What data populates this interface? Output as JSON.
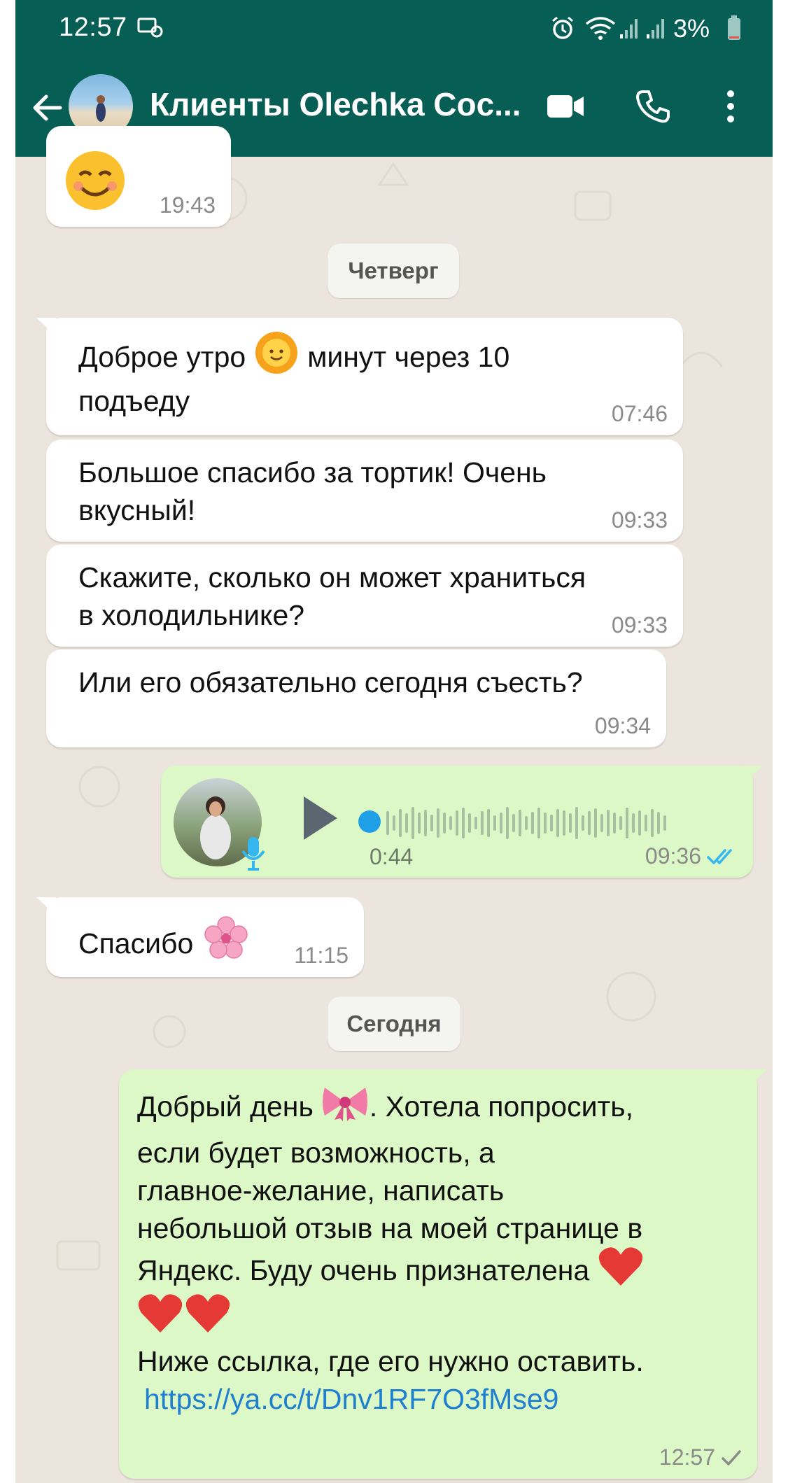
{
  "status": {
    "time": "12:57",
    "battery": "3%"
  },
  "header": {
    "title": "Клиенты Olechka Coc..."
  },
  "messages": {
    "m0_time": "19:43",
    "day1": "Четверг",
    "m1_line1": "Доброе утро",
    "m1_line1b": "минут через 10",
    "m1_line2": "подъеду",
    "m1_time": "07:46",
    "m2_line1": "Большое спасибо за тортик! Очень",
    "m2_line2": "вкусный!",
    "m2_time": "09:33",
    "m3_line1": "Скажите, сколько он может храниться",
    "m3_line2": "в холодильнике?",
    "m3_time": "09:33",
    "m4_line1": "Или его обязательно сегодня съесть?",
    "m4_time": "09:34",
    "voice_duration": "0:44",
    "voice_time": "09:36",
    "voice_progress": 0,
    "m6_text": "Спасибо",
    "m6_time": "11:15",
    "day2": "Сегодня",
    "m7_l1a": "Добрый день",
    "m7_l1b": ".  Хотела попросить,",
    "m7_l2": "если будет возможность,  а",
    "m7_l3": "главное-желание,  написать",
    "m7_l4": "небольшой отзыв на моей странице в",
    "m7_l5": "Яндекс.  Буду очень признателена",
    "m7_l7": "Ниже ссылка, где его нужно оставить.",
    "m7_link": "https://ya.cc/t/Dnv1RF7O3fMse9",
    "m7_time": "12:57"
  },
  "icons": {
    "back": "arrow-left-icon",
    "video": "video-camera-icon",
    "call": "phone-icon",
    "menu": "more-vertical-icon",
    "play": "play-icon",
    "mic": "microphone-icon",
    "read": "double-check-icon",
    "sent": "single-check-icon"
  },
  "colors": {
    "header": "#075e54",
    "wallpaper": "#ece5dd",
    "incoming": "#ffffff",
    "outgoing": "#dcf8c6",
    "read_tick": "#34b7f1",
    "link": "#1f7fcf"
  }
}
